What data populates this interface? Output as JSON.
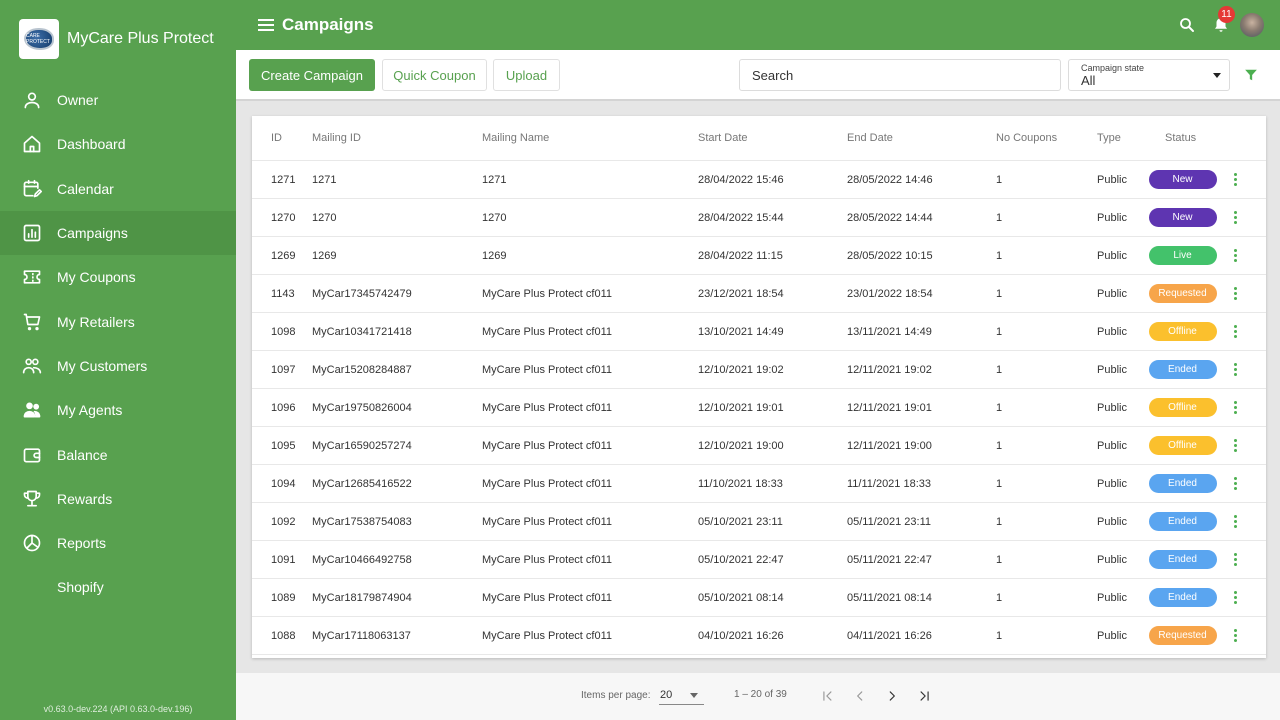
{
  "app": {
    "name": "MyCare Plus Protect",
    "logo_text": "CARE PROTECT",
    "version": "v0.63.0-dev.224 (API 0.63.0-dev.196)"
  },
  "sidebar": {
    "items": [
      {
        "label": "Owner",
        "icon": "user-icon",
        "active": false
      },
      {
        "label": "Dashboard",
        "icon": "home-icon",
        "active": false
      },
      {
        "label": "Calendar",
        "icon": "calendar-edit-icon",
        "active": false
      },
      {
        "label": "Campaigns",
        "icon": "bar-chart-icon",
        "active": true
      },
      {
        "label": "My Coupons",
        "icon": "ticket-icon",
        "active": false
      },
      {
        "label": "My Retailers",
        "icon": "cart-icon",
        "active": false
      },
      {
        "label": "My Customers",
        "icon": "users-icon",
        "active": false
      },
      {
        "label": "My Agents",
        "icon": "agents-icon",
        "active": false
      },
      {
        "label": "Balance",
        "icon": "wallet-icon",
        "active": false
      },
      {
        "label": "Rewards",
        "icon": "trophy-icon",
        "active": false
      },
      {
        "label": "Reports",
        "icon": "pie-chart-icon",
        "active": false
      },
      {
        "label": "Shopify",
        "icon": "",
        "active": false
      }
    ]
  },
  "header": {
    "title": "Campaigns",
    "notification_count": "11"
  },
  "toolbar": {
    "create_label": "Create Campaign",
    "quick_coupon_label": "Quick Coupon",
    "upload_label": "Upload",
    "search_placeholder": "Search",
    "campaign_state_label": "Campaign state",
    "campaign_state_value": "All"
  },
  "colors": {
    "brand": "#58a14f",
    "status": {
      "New": "#5e35b1",
      "Live": "#43c26b",
      "Requested": "#f7a54a",
      "Offline": "#fbc02d",
      "Ended": "#5aa5f0"
    }
  },
  "table": {
    "columns": [
      "ID",
      "Mailing ID",
      "Mailing Name",
      "Start Date",
      "End Date",
      "No Coupons",
      "Type",
      "Status"
    ],
    "rows": [
      {
        "id": "1271",
        "mailing_id": "1271",
        "mailing_name": "1271",
        "start": "28/04/2022 15:46",
        "end": "28/05/2022 14:46",
        "coupons": "1",
        "type": "Public",
        "status": "New"
      },
      {
        "id": "1270",
        "mailing_id": "1270",
        "mailing_name": "1270",
        "start": "28/04/2022 15:44",
        "end": "28/05/2022 14:44",
        "coupons": "1",
        "type": "Public",
        "status": "New"
      },
      {
        "id": "1269",
        "mailing_id": "1269",
        "mailing_name": "1269",
        "start": "28/04/2022 11:15",
        "end": "28/05/2022 10:15",
        "coupons": "1",
        "type": "Public",
        "status": "Live"
      },
      {
        "id": "1143",
        "mailing_id": "MyCar17345742479",
        "mailing_name": "MyCare Plus Protect cf011",
        "start": "23/12/2021 18:54",
        "end": "23/01/2022 18:54",
        "coupons": "1",
        "type": "Public",
        "status": "Requested"
      },
      {
        "id": "1098",
        "mailing_id": "MyCar10341721418",
        "mailing_name": "MyCare Plus Protect cf011",
        "start": "13/10/2021 14:49",
        "end": "13/11/2021 14:49",
        "coupons": "1",
        "type": "Public",
        "status": "Offline"
      },
      {
        "id": "1097",
        "mailing_id": "MyCar15208284887",
        "mailing_name": "MyCare Plus Protect cf011",
        "start": "12/10/2021 19:02",
        "end": "12/11/2021 19:02",
        "coupons": "1",
        "type": "Public",
        "status": "Ended"
      },
      {
        "id": "1096",
        "mailing_id": "MyCar19750826004",
        "mailing_name": "MyCare Plus Protect cf011",
        "start": "12/10/2021 19:01",
        "end": "12/11/2021 19:01",
        "coupons": "1",
        "type": "Public",
        "status": "Offline"
      },
      {
        "id": "1095",
        "mailing_id": "MyCar16590257274",
        "mailing_name": "MyCare Plus Protect cf011",
        "start": "12/10/2021 19:00",
        "end": "12/11/2021 19:00",
        "coupons": "1",
        "type": "Public",
        "status": "Offline"
      },
      {
        "id": "1094",
        "mailing_id": "MyCar12685416522",
        "mailing_name": "MyCare Plus Protect cf011",
        "start": "11/10/2021 18:33",
        "end": "11/11/2021 18:33",
        "coupons": "1",
        "type": "Public",
        "status": "Ended"
      },
      {
        "id": "1092",
        "mailing_id": "MyCar17538754083",
        "mailing_name": "MyCare Plus Protect cf011",
        "start": "05/10/2021 23:11",
        "end": "05/11/2021 23:11",
        "coupons": "1",
        "type": "Public",
        "status": "Ended"
      },
      {
        "id": "1091",
        "mailing_id": "MyCar10466492758",
        "mailing_name": "MyCare Plus Protect cf011",
        "start": "05/10/2021 22:47",
        "end": "05/11/2021 22:47",
        "coupons": "1",
        "type": "Public",
        "status": "Ended"
      },
      {
        "id": "1089",
        "mailing_id": "MyCar18179874904",
        "mailing_name": "MyCare Plus Protect cf011",
        "start": "05/10/2021 08:14",
        "end": "05/11/2021 08:14",
        "coupons": "1",
        "type": "Public",
        "status": "Ended"
      },
      {
        "id": "1088",
        "mailing_id": "MyCar17118063137",
        "mailing_name": "MyCare Plus Protect cf011",
        "start": "04/10/2021 16:26",
        "end": "04/11/2021 16:26",
        "coupons": "1",
        "type": "Public",
        "status": "Requested"
      }
    ]
  },
  "paginator": {
    "items_per_page_label": "Items per page:",
    "items_per_page": "20",
    "range": "1 – 20 of 39"
  }
}
